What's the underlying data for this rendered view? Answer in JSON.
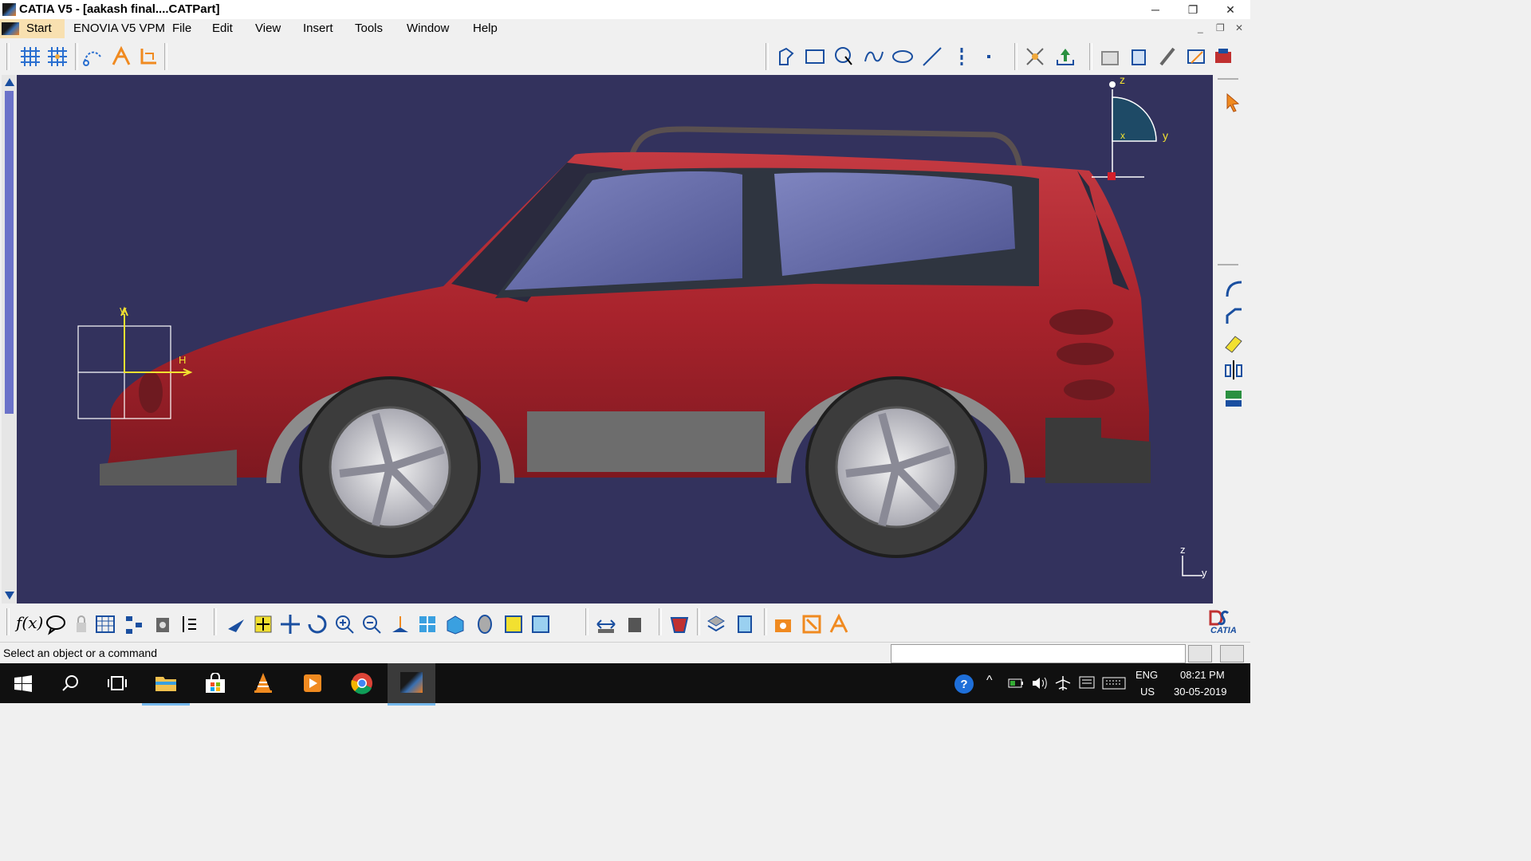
{
  "window": {
    "title": "CATIA V5 - [aakash final....CATPart]",
    "minimize_glyph": "─",
    "restore_glyph": "❐",
    "close_glyph": "✕"
  },
  "menu": {
    "items": [
      "Start",
      "ENOVIA V5 VPM",
      "File",
      "Edit",
      "View",
      "Insert",
      "Tools",
      "Window",
      "Help"
    ],
    "mdi_glyphs": [
      "_",
      "❐",
      "✕"
    ]
  },
  "viewport": {
    "background": "#33325d",
    "compass_labels": {
      "z": "z",
      "y": "y",
      "x": "x"
    },
    "sketch_axis_labels": {
      "v": "V",
      "h": "H"
    },
    "mini_axis_labels": {
      "z": "z",
      "y": "y"
    }
  },
  "status": {
    "text": "Select an object or a command",
    "command_input_value": ""
  },
  "taskbar": {
    "language": "ENG",
    "region": "US",
    "time": "08:21 PM",
    "date": "30-05-2019"
  },
  "brand": {
    "catia_text": "CATIA"
  },
  "icons": {
    "top_left": [
      "grid-icon",
      "snap-grid-icon",
      "sketch-analysis-icon",
      "3d-sketch-icon",
      "axis-icon"
    ],
    "top_right": [
      "profile-icon",
      "rectangle-icon",
      "circle-icon",
      "spline-icon",
      "ellipse-icon",
      "line-icon",
      "axis-line-icon",
      "point-icon",
      "constraint-icon",
      "exit-workbench-icon",
      "cut-part-icon",
      "measure-icon",
      "transform-icon",
      "construct-icon",
      "animate-icon"
    ],
    "right_bar": [
      "select-arrow-icon",
      "corner-icon",
      "chamfer-icon",
      "eraser-icon",
      "mirror-icon",
      "project-icon"
    ],
    "bottom": [
      "formula-icon",
      "chat-icon",
      "lock-icon",
      "table-icon",
      "hierarchy-icon",
      "scan-icon",
      "param-icon",
      "fly-icon",
      "fit-all-icon",
      "pan-icon",
      "rotate-icon",
      "zoom-in-icon",
      "zoom-out-icon",
      "normal-view-icon",
      "multi-view-icon",
      "iso-view-icon",
      "render-icon",
      "hide-show-icon",
      "swap-icon",
      "measure-between-icon",
      "measure-item-icon",
      "render-style-icon",
      "layer-icon",
      "stack-icon",
      "dress-up-icon",
      "fixed-icon",
      "pattern-icon"
    ]
  },
  "colors": {
    "car_body": "#a8232c",
    "accent": "#f0a83a"
  }
}
